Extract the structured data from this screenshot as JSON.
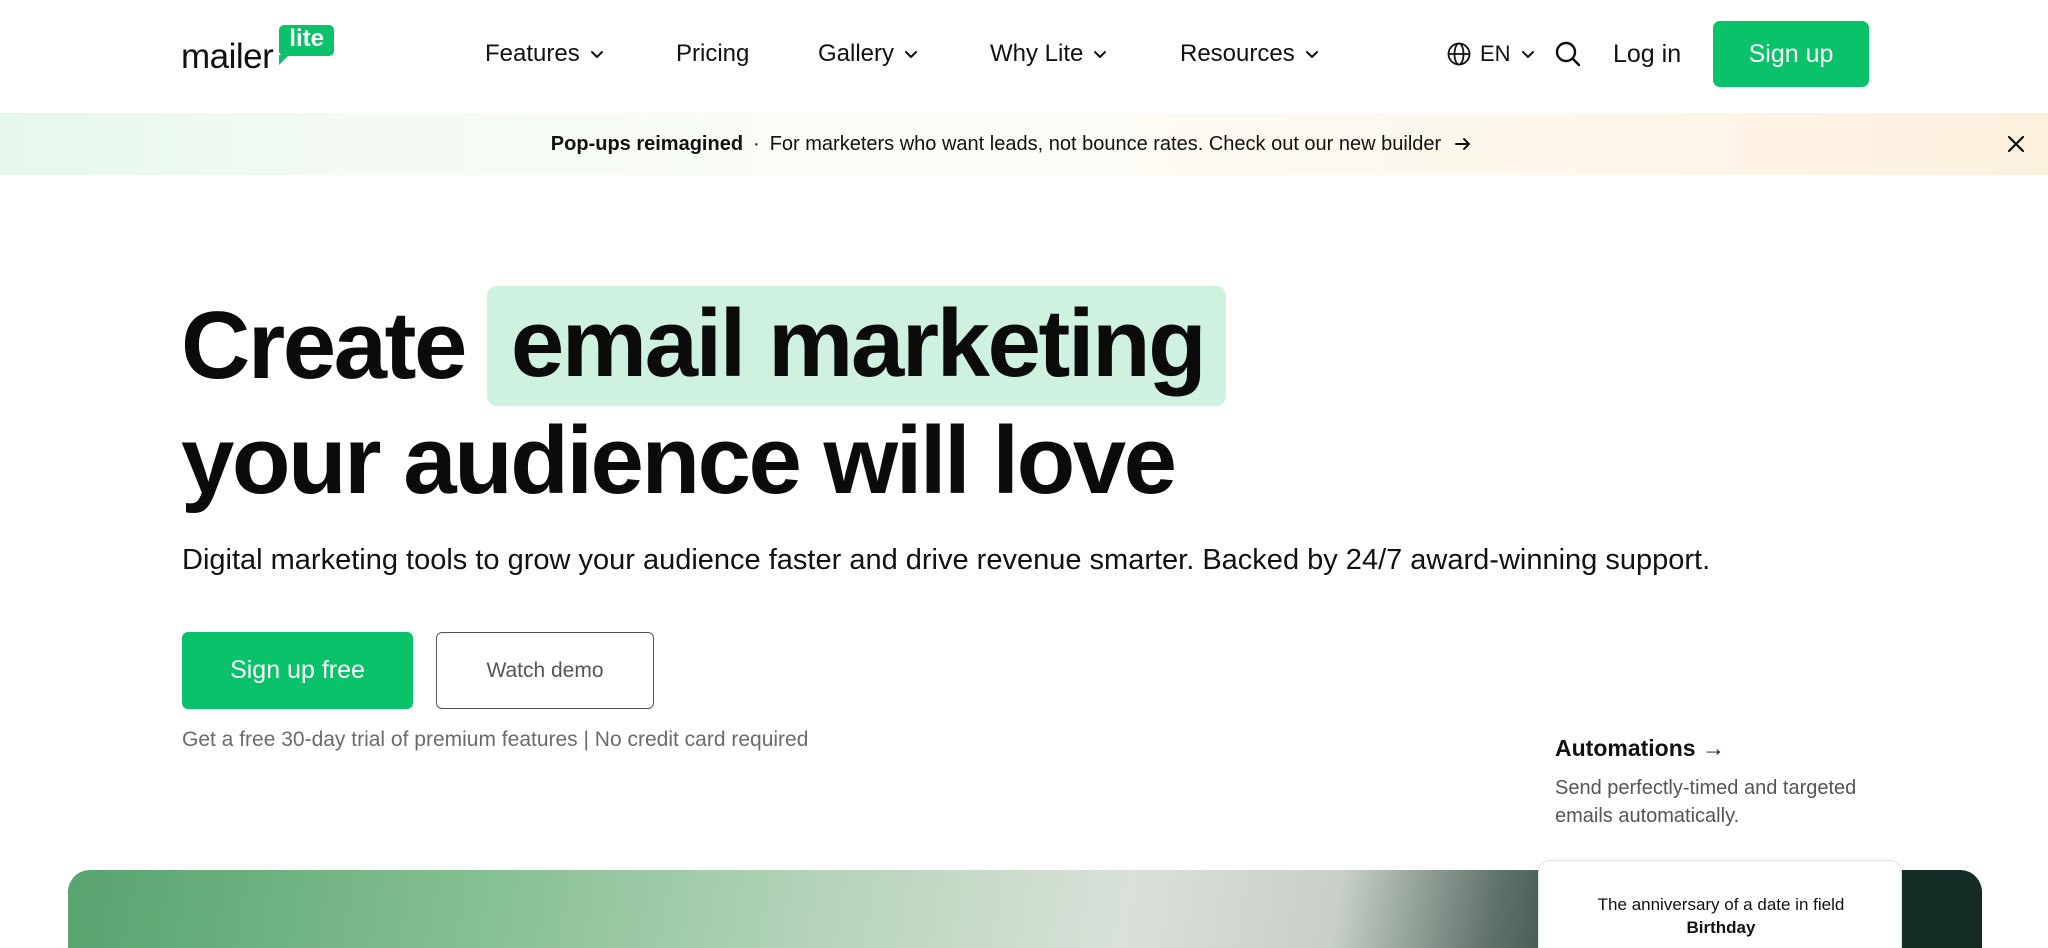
{
  "brand": {
    "logo_word": "mailer",
    "logo_badge": "lite",
    "accent_color": "#09c269",
    "highlight_color": "#cff1df"
  },
  "nav": {
    "items": [
      {
        "label": "Features",
        "has_dropdown": true
      },
      {
        "label": "Pricing",
        "has_dropdown": false
      },
      {
        "label": "Gallery",
        "has_dropdown": true
      },
      {
        "label": "Why Lite",
        "has_dropdown": true
      },
      {
        "label": "Resources",
        "has_dropdown": true
      }
    ],
    "language": "EN",
    "language_icon": "globe-icon",
    "search_icon": "search-icon",
    "login_label": "Log in",
    "signup_label": "Sign up"
  },
  "banner": {
    "strong": "Pop-ups reimagined",
    "separator": "·",
    "text": "For marketers who want leads, not bounce rates. Check out our new builder",
    "arrow_icon": "arrow-right-icon",
    "close_icon": "close-icon"
  },
  "hero": {
    "title_word": "Create",
    "title_highlight": "email marketing",
    "title_line2": "your audience will love",
    "subtitle": "Digital marketing tools to grow your audience faster and drive revenue smarter. Backed by 24/7 award-winning support.",
    "primary_cta": "Sign up free",
    "secondary_cta": "Watch demo",
    "note": "Get a free 30-day trial of premium features | No credit card required"
  },
  "feature": {
    "title": "Automations →",
    "description": "Send perfectly-timed and targeted emails automatically.",
    "card_text": "The anniversary of a date in field",
    "card_field": "Birthday"
  }
}
